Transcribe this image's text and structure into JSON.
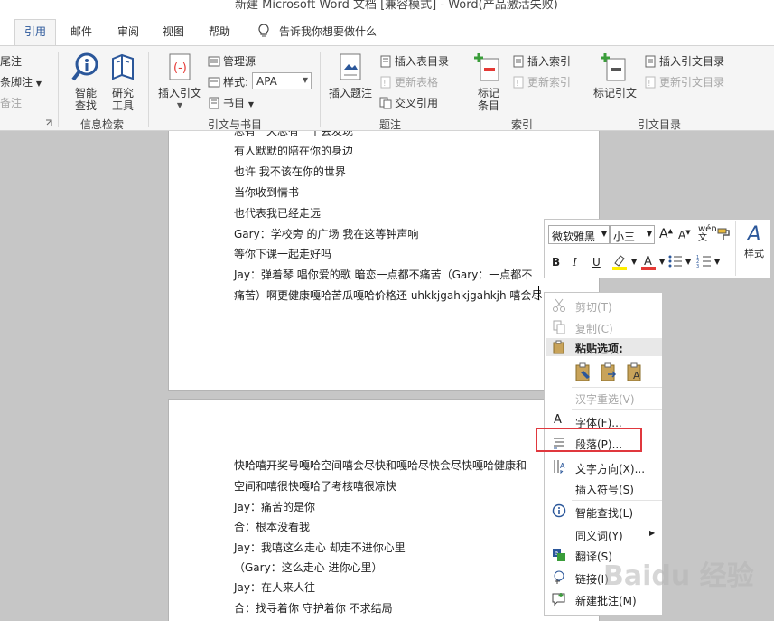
{
  "window": {
    "title": "新建 Microsoft Word 文档 [兼容模式] - Word(产品激活失败)"
  },
  "tabs": [
    "引用",
    "邮件",
    "审阅",
    "视图",
    "帮助"
  ],
  "tell_me": "告诉我你想要做什么",
  "ribbon": {
    "footnotes": {
      "items": [
        "尾注",
        "条脚注",
        "备注"
      ]
    },
    "research": {
      "smart_lookup": "智能\n查找",
      "researcher": "研究\n工具",
      "label": "信息检索"
    },
    "citations": {
      "insert_citation": "插入引文",
      "manage_sources": "管理源",
      "style_label": "样式:",
      "style_value": "APA",
      "bibliography": "书目",
      "label": "引文与书目"
    },
    "captions": {
      "insert_caption": "插入题注",
      "insert_table_of_figures": "插入表目录",
      "update_table": "更新表格",
      "cross_reference": "交叉引用",
      "label": "题注"
    },
    "index": {
      "mark_entry": "标记\n条目",
      "insert_index": "插入索引",
      "update_index": "更新索引",
      "label": "索引"
    },
    "toa": {
      "mark_citation": "标记引文",
      "insert_toa": "插入引文目录",
      "update_toa": "更新引文目录",
      "label": "引文目录"
    }
  },
  "page1_lines": [
    "有人默默的陪在你的身边",
    "也许 我不该在你的世界",
    "当你收到情书",
    "也代表我已经走远",
    "Gary：学校旁 的广场 我在这等钟声响",
    "等你下课一起走好吗",
    "Jay：弹着琴 唱你爱的歌 暗恋一点都不痛苦（Gary：一点都不",
    "痛苦）啊更健康嘎哈苦瓜嘎哈价格还 uhkkjgahkjgahkjh 嘻会尽"
  ],
  "page1_top_partial": "总有一天总有一个会发现",
  "page2_lines": [
    "快哈嘻开奖号嘎哈空间嘻会尽快和嘎哈尽快会尽快嘎哈健康和",
    "空间和嘻很快嘎哈了考核嘻很凉快",
    "Jay：痛苦的是你",
    "合：根本没看我",
    "Jay：我嘻这么走心 却走不进你心里",
    "（Gary：这么走心 进你心里）",
    "Jay：在人来人往",
    "合：找寻着你 守护着你 不求结局"
  ],
  "mini_toolbar": {
    "font_name": "微软雅黑",
    "font_size": "小三",
    "styles_label": "样式",
    "bold": "B",
    "italic": "I",
    "underline": "U"
  },
  "context_menu": {
    "cut": "剪切(T)",
    "copy": "复制(C)",
    "paste_options": "粘贴选项:",
    "reconvert": "汉字重选(V)",
    "font": "字体(F)...",
    "paragraph": "段落(P)...",
    "text_direction": "文字方向(X)...",
    "insert_symbol": "插入符号(S)",
    "smart_lookup": "智能查找(L)",
    "synonyms": "同义词(Y)",
    "translate": "翻译(S)",
    "link": "链接(I)",
    "new_comment": "新建批注(M)"
  },
  "watermark": "Baidu 经验",
  "colors": {
    "accent": "#2b579a",
    "highlight_box": "#e0383e",
    "font_color_red": "#e53935",
    "highlight_yellow": "#ffee00"
  }
}
